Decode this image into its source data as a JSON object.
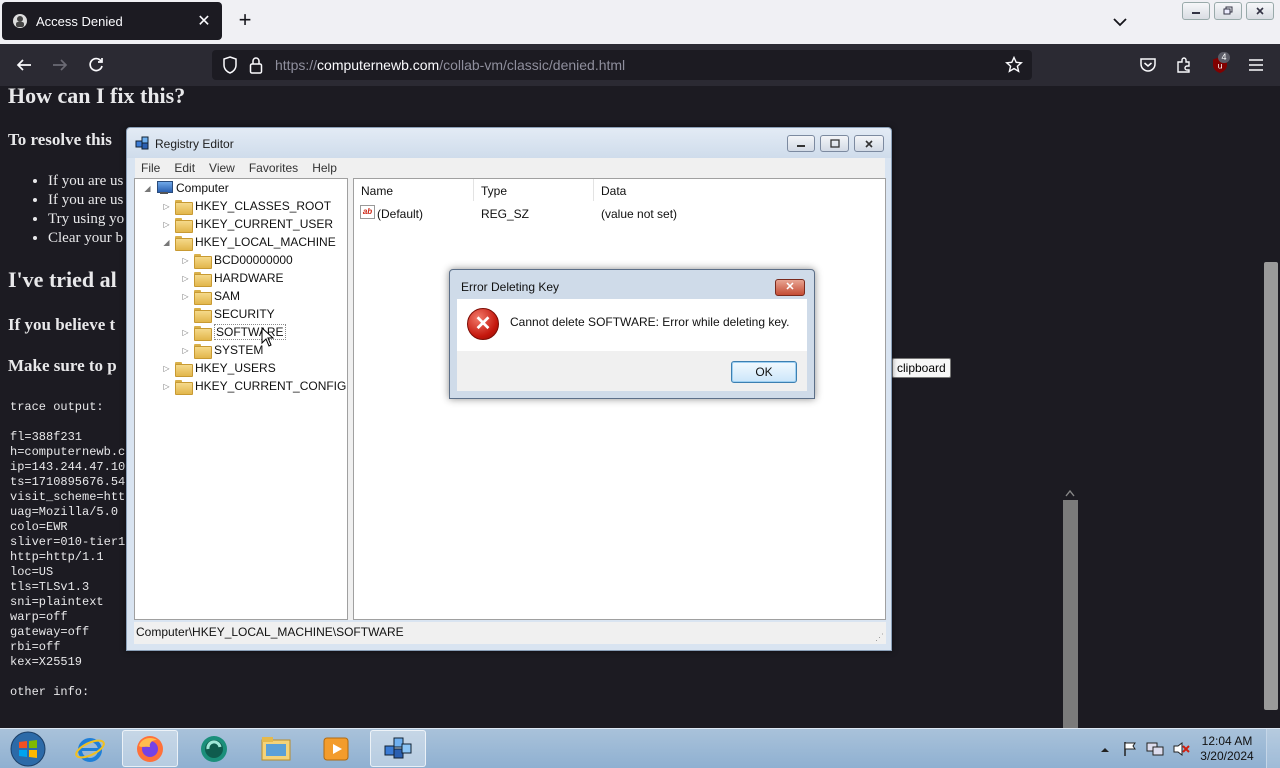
{
  "browser": {
    "tab": {
      "title": "Access Denied",
      "close": "✕"
    },
    "new_tab": "+",
    "url": {
      "prefix": "https://",
      "domain": "computernewb.com",
      "path": "/collab-vm/classic/denied.html"
    },
    "extension_badge": "4"
  },
  "page": {
    "heading_fix": "How can I fix this?",
    "resolve_text": "To resolve this",
    "bullets": [
      "If you are us",
      "If you are us",
      "Try using yo",
      "Clear your b"
    ],
    "heading_tried": "I've tried al",
    "believe_text": "If you believe t",
    "make_sure_text": "Make sure to p",
    "trace_label": "trace output:",
    "trace_lines": "fl=388f231\nh=computernewb.co\nip=143.244.47.10\nts=1710895676.54\nvisit_scheme=http\nuag=Mozilla/5.0 (\ncolo=EWR\nsliver=010-tier1\nhttp=http/1.1\nloc=US\ntls=TLSv1.3\nsni=plaintext\nwarp=off\ngateway=off\nrbi=off\nkex=X25519",
    "other_info": "other info:",
    "clipboard_tooltip": "clipboard"
  },
  "regedit": {
    "title": "Registry Editor",
    "menu": [
      "File",
      "Edit",
      "View",
      "Favorites",
      "Help"
    ],
    "tree": {
      "root": "Computer",
      "hkcr": "HKEY_CLASSES_ROOT",
      "hkcu": "HKEY_CURRENT_USER",
      "hklm": "HKEY_LOCAL_MACHINE",
      "bcd": "BCD00000000",
      "hardware": "HARDWARE",
      "sam": "SAM",
      "security": "SECURITY",
      "software": "SOFTWARE",
      "system": "SYSTEM",
      "hku": "HKEY_USERS",
      "hkcc": "HKEY_CURRENT_CONFIG"
    },
    "columns": {
      "name": "Name",
      "type": "Type",
      "data": "Data"
    },
    "rows": [
      {
        "name": "(Default)",
        "type": "REG_SZ",
        "data": "(value not set)"
      }
    ],
    "status": "Computer\\HKEY_LOCAL_MACHINE\\SOFTWARE"
  },
  "dialog": {
    "title": "Error Deleting Key",
    "message": "Cannot delete SOFTWARE:  Error while deleting key.",
    "ok": "OK",
    "close": "✕"
  },
  "taskbar": {
    "time": "12:04 AM",
    "date": "3/20/2024"
  }
}
